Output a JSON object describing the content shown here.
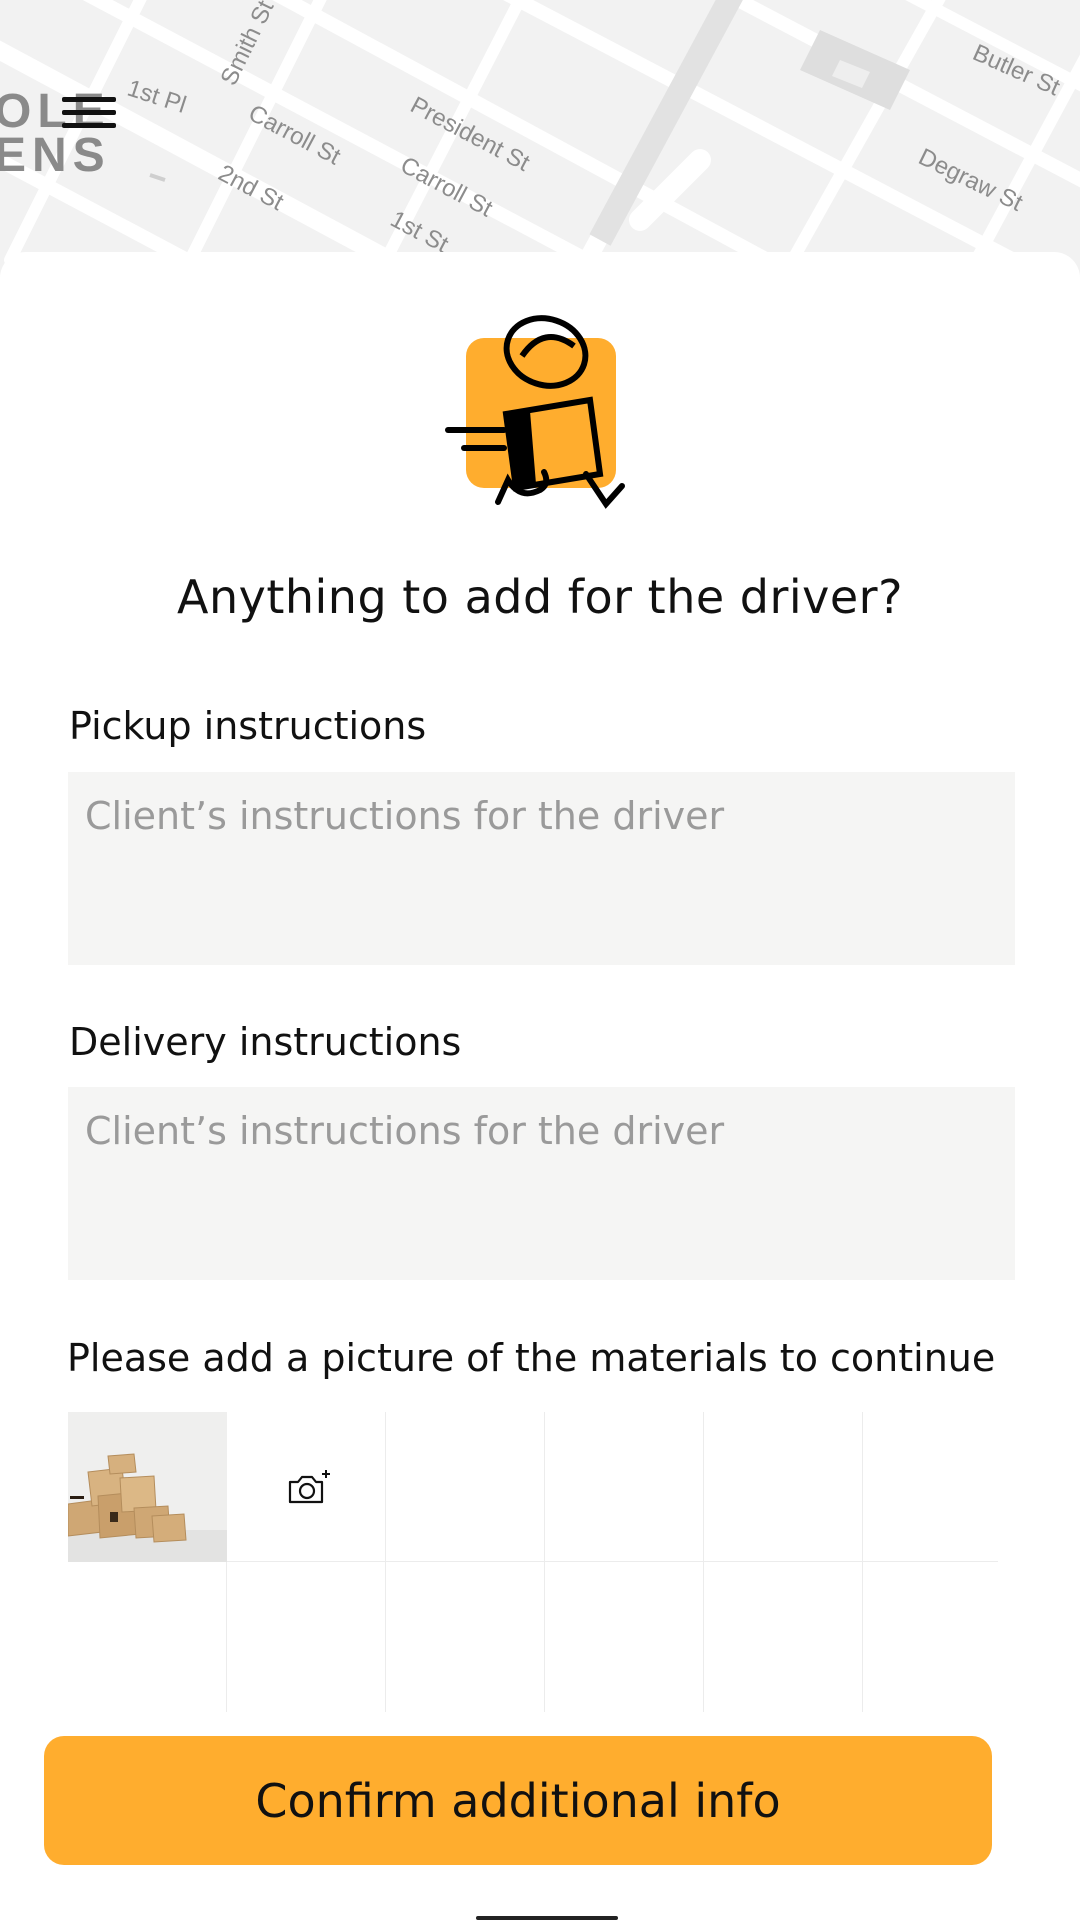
{
  "map": {
    "streets": [
      "Butler St",
      "Smith St",
      "1st Pl",
      "Carroll St",
      "President St",
      "2nd St",
      "Carroll St",
      "1st St",
      "Degraw St"
    ],
    "brand_fragment": [
      "OLE",
      "ENS"
    ]
  },
  "menu": {
    "icon": "hamburger-menu-icon"
  },
  "sheet": {
    "illustration": "courier-running-with-box-icon",
    "title": "Anything to add for the driver?",
    "pickup": {
      "label": "Pickup instructions",
      "placeholder": "Client’s instructions for the driver",
      "value": ""
    },
    "delivery": {
      "label": "Delivery instructions",
      "placeholder": "Client’s instructions for the driver",
      "value": ""
    },
    "photos": {
      "label": "Please add a picture of the materials to continue",
      "thumbnail": "cardboard-boxes-photo",
      "add_icon": "add-camera-icon"
    },
    "confirm_label": "Confirm additional info"
  },
  "colors": {
    "accent": "#ffad2e",
    "field_bg": "#f5f5f4",
    "map_bg": "#f2f2f2"
  }
}
